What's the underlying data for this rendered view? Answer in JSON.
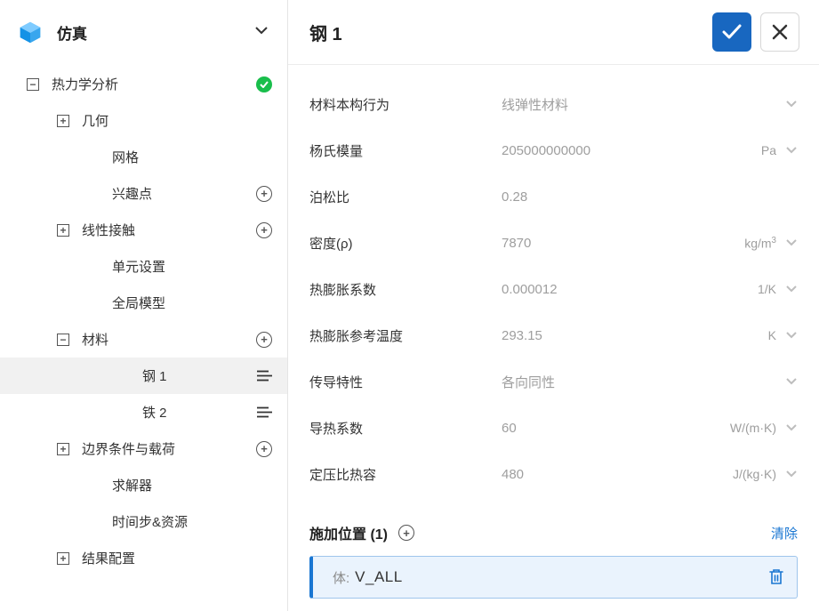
{
  "sidebar": {
    "title": "仿真",
    "root": {
      "label": "热力学分析",
      "hasCheck": true
    },
    "nodes": [
      {
        "label": "几何",
        "indent": 1,
        "toggle": "plus"
      },
      {
        "label": "网格",
        "indent": 2
      },
      {
        "label": "兴趣点",
        "indent": 2,
        "right": "add"
      },
      {
        "label": "线性接触",
        "indent": 1,
        "toggle": "plus",
        "right": "add"
      },
      {
        "label": "单元设置",
        "indent": 2
      },
      {
        "label": "全局模型",
        "indent": 2
      },
      {
        "label": "材料",
        "indent": 1,
        "toggle": "minus",
        "right": "add"
      },
      {
        "label": "钢 1",
        "indent": 3,
        "right": "list",
        "selected": true
      },
      {
        "label": "铁 2",
        "indent": 3,
        "right": "list"
      },
      {
        "label": "边界条件与载荷",
        "indent": 1,
        "toggle": "plus",
        "right": "add"
      },
      {
        "label": "求解器",
        "indent": 2
      },
      {
        "label": "时间步&资源",
        "indent": 2
      },
      {
        "label": "结果配置",
        "indent": 1,
        "toggle": "plus"
      }
    ]
  },
  "main": {
    "title": "钢 1",
    "props": [
      {
        "label": "材料本构行为",
        "value": "线弹性材料",
        "unit": "",
        "chevron": true
      },
      {
        "label": "杨氏模量",
        "value": "205000000000",
        "unit": "Pa",
        "chevron": true
      },
      {
        "label": "泊松比",
        "value": "0.28",
        "unit": "",
        "chevron": false
      },
      {
        "label": "密度(ρ)",
        "value": "7870",
        "unit": "kg/m³",
        "chevron": true
      },
      {
        "label": "热膨胀系数",
        "value": "0.000012",
        "unit": "1/K",
        "chevron": true
      },
      {
        "label": "热膨胀参考温度",
        "value": "293.15",
        "unit": "K",
        "chevron": true
      },
      {
        "label": "传导特性",
        "value": "各向同性",
        "unit": "",
        "chevron": true
      },
      {
        "label": "导热系数",
        "value": "60",
        "unit": "W/(m·K)",
        "chevron": true
      },
      {
        "label": "定压比热容",
        "value": "480",
        "unit": "J/(kg·K)",
        "chevron": true
      }
    ],
    "assign": {
      "title": "施加位置 (1)",
      "clear": "清除",
      "target_prefix": "体:",
      "target_value": "V_ALL"
    }
  }
}
